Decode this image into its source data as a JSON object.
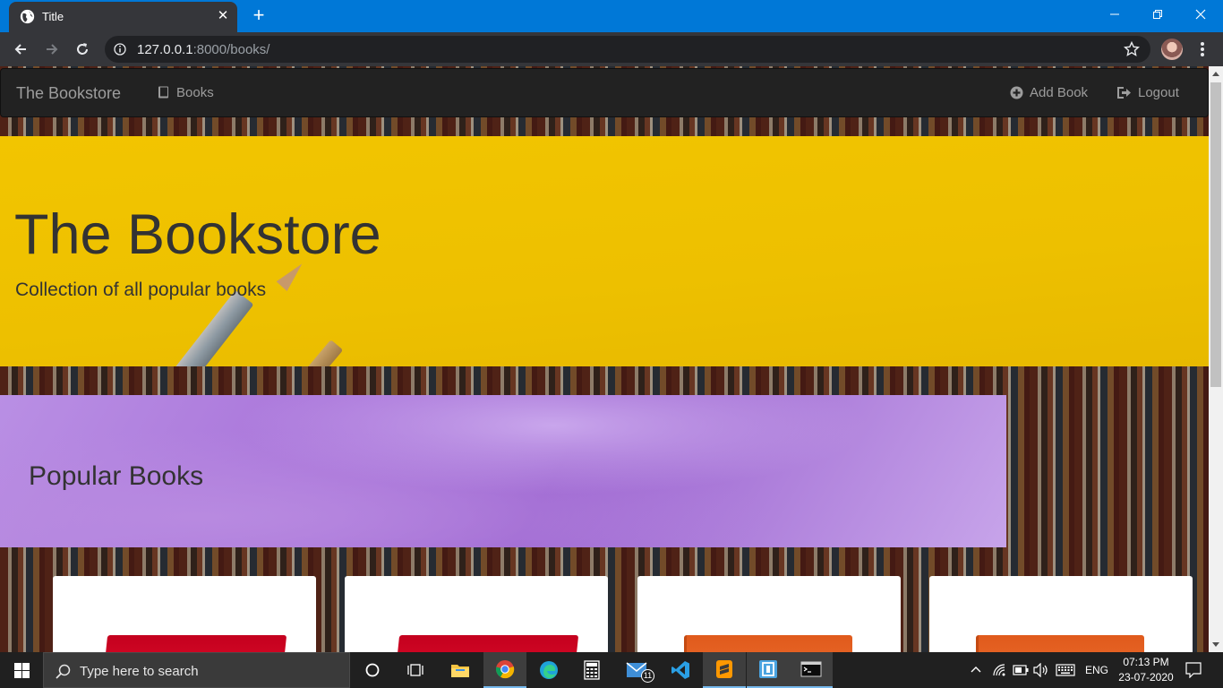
{
  "browser": {
    "tab_title": "Title",
    "close_tab_glyph": "✕",
    "new_tab_glyph": "+",
    "url_host": "127.0.0.1",
    "url_path": ":8000/books/"
  },
  "navbar": {
    "brand": "The Bookstore",
    "books_label": "Books",
    "add_book_label": "Add Book",
    "logout_label": "Logout"
  },
  "jumbotron": {
    "title": "The Bookstore",
    "subtitle": "Collection of all popular books"
  },
  "popular": {
    "heading": "Popular Books"
  },
  "cards": [
    {
      "cover_color": "#d0021b"
    },
    {
      "cover_color": "#d0021b"
    },
    {
      "cover_color": "#e8621f"
    },
    {
      "cover_color": "#e8621f"
    }
  ],
  "taskbar": {
    "search_placeholder": "Type here to search",
    "mail_badge": "11",
    "language": "ENG",
    "time": "07:13 PM",
    "date": "23-07-2020"
  },
  "colors": {
    "titlebar": "#0078d7",
    "jumbotron": "#f2c500",
    "popular": "#a873d9",
    "navbar": "#222222"
  }
}
